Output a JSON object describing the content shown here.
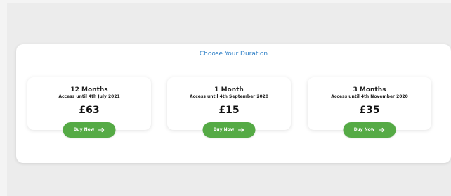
{
  "heading": "Choose Your Duration",
  "plans": [
    {
      "title": "12 Months",
      "access": "Access until 4th July 2021",
      "price": "£63",
      "button_label": "Buy Now"
    },
    {
      "title": "1 Month",
      "access": "Access until 4th September 2020",
      "price": "£15",
      "button_label": "Buy Now"
    },
    {
      "title": "3 Months",
      "access": "Access until 4th November 2020",
      "price": "£35",
      "button_label": "Buy Now"
    }
  ],
  "icons": {
    "button_icon": "arrow-right-icon"
  },
  "colors": {
    "accent": "#2f80c7",
    "button": "#55aa45",
    "background": "#ececec",
    "card": "#ffffff"
  }
}
